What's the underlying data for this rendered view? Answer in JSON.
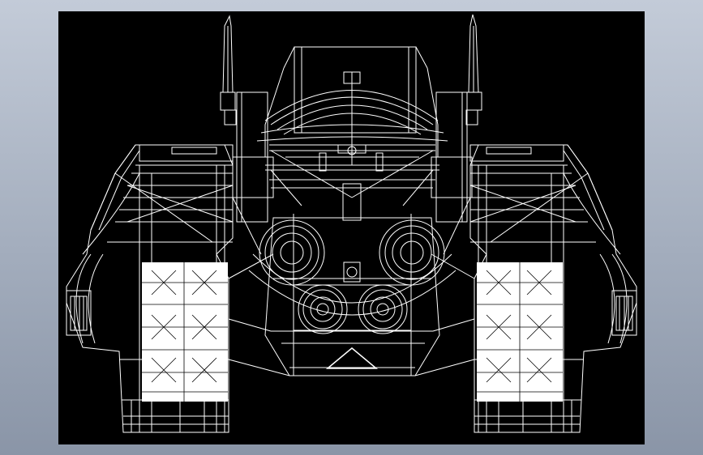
{
  "viewport": {
    "background": "#000000",
    "line_color": "#ffffff",
    "frame_color": "#a9b2c2"
  },
  "model": {
    "view": "front",
    "render_mode": "wireframe",
    "subject": "tracked-vehicle-icon"
  }
}
